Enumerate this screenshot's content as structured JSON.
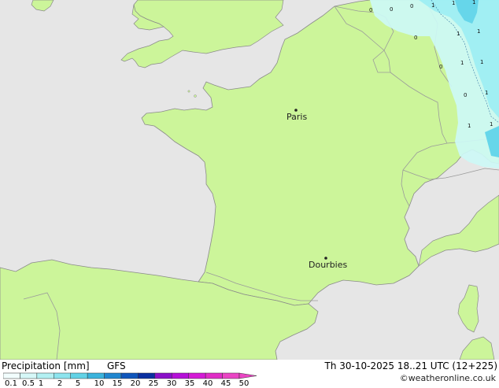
{
  "map": {
    "cities": [
      {
        "name": "Paris"
      },
      {
        "name": "Dourbies"
      }
    ],
    "precip_values": [
      "0",
      "0",
      "1",
      "1",
      "1",
      "0",
      "1",
      "1",
      "0",
      "1",
      "0",
      "1",
      "1",
      "0",
      "1",
      "1"
    ],
    "colors": {
      "sea": "#e6e6e6",
      "land": "#ccf59a",
      "border": "#9a9a9a",
      "coast": "#8a8a8a",
      "precip_light": "#cdf8f6",
      "precip_mid": "#9eeef2",
      "precip_strong": "#66d6ea"
    }
  },
  "legend": {
    "product": "Precipitation [mm]",
    "model": "GFS",
    "valid_time": "Th 30-10-2025 18..21 UTC (12+225)",
    "credit": "©weatheronline.co.uk",
    "scale_labels": [
      "0.1",
      "0.5",
      "1",
      "2",
      "5",
      "10",
      "15",
      "20",
      "25",
      "30",
      "35",
      "40",
      "45",
      "50"
    ],
    "scale_colors": [
      "#f2fdfd",
      "#d6f8f8",
      "#b3f0f2",
      "#8de4ee",
      "#62d2e6",
      "#3ab3dc",
      "#1f86cf",
      "#0f56bb",
      "#0a2fa0",
      "#8a10c8",
      "#b510d8",
      "#d41ad6",
      "#e02cc6",
      "#ea45c4"
    ]
  }
}
